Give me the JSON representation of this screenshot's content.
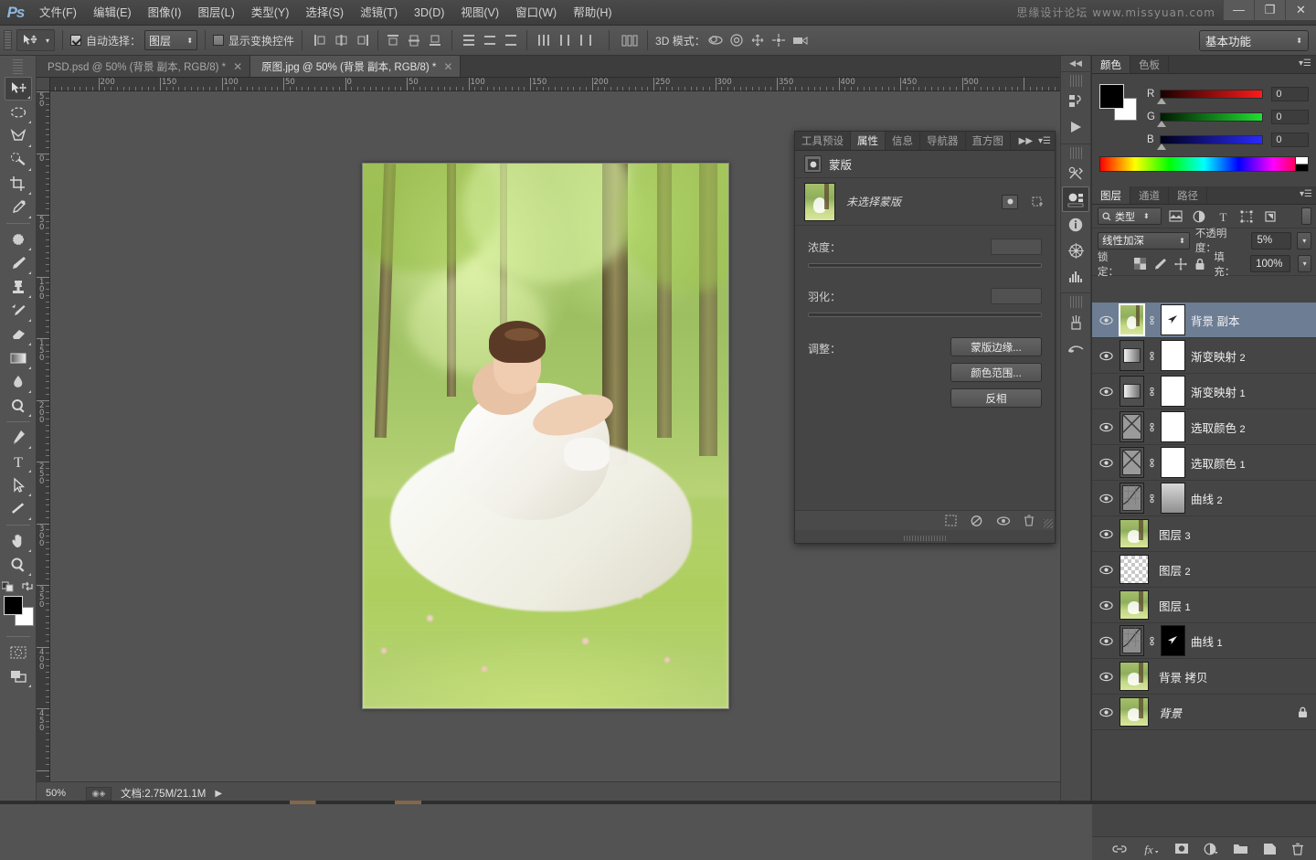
{
  "app": {
    "logo": "Ps",
    "watermark": "思缘设计论坛  www.missyuan.com"
  },
  "menubar": {
    "items": [
      {
        "label": "文件(F)"
      },
      {
        "label": "编辑(E)"
      },
      {
        "label": "图像(I)"
      },
      {
        "label": "图层(L)"
      },
      {
        "label": "类型(Y)"
      },
      {
        "label": "选择(S)"
      },
      {
        "label": "滤镜(T)"
      },
      {
        "label": "3D(D)"
      },
      {
        "label": "视图(V)"
      },
      {
        "label": "窗口(W)"
      },
      {
        "label": "帮助(H)"
      }
    ],
    "window_controls": {
      "minimize": "—",
      "restore": "❐",
      "close": "✕"
    }
  },
  "options_bar": {
    "auto_select_label": "自动选择：",
    "auto_select_checked": true,
    "auto_select_value": "图层",
    "show_transform_label": "显示变换控件",
    "show_transform_checked": false,
    "three_d_label": "3D 模式：",
    "workspace": "基本功能"
  },
  "toolbar": {
    "tools": [
      {
        "name": "move-tool",
        "selected": true
      },
      {
        "name": "marquee-tool",
        "selected": false
      },
      {
        "name": "lasso-tool",
        "selected": false
      },
      {
        "name": "quick-selection-tool",
        "selected": false
      },
      {
        "name": "crop-tool",
        "selected": false
      },
      {
        "name": "eyedropper-tool",
        "selected": false
      },
      {
        "name": "healing-brush-tool",
        "selected": false
      },
      {
        "name": "brush-tool",
        "selected": false
      },
      {
        "name": "clone-stamp-tool",
        "selected": false
      },
      {
        "name": "history-brush-tool",
        "selected": false
      },
      {
        "name": "eraser-tool",
        "selected": false
      },
      {
        "name": "gradient-tool",
        "selected": false
      },
      {
        "name": "blur-tool",
        "selected": false
      },
      {
        "name": "dodge-tool",
        "selected": false
      },
      {
        "name": "pen-tool",
        "selected": false
      },
      {
        "name": "type-tool",
        "selected": false
      },
      {
        "name": "path-selection-tool",
        "selected": false
      },
      {
        "name": "line-tool",
        "selected": false
      },
      {
        "name": "hand-tool",
        "selected": false
      },
      {
        "name": "zoom-tool",
        "selected": false
      }
    ],
    "foreground_color": "#000000",
    "background_color": "#ffffff"
  },
  "document_tabs": [
    {
      "label": "PSD.psd @ 50% (背景 副本, RGB/8) *",
      "active": false,
      "close": "✕"
    },
    {
      "label": "原图.jpg @ 50% (背景 副本, RGB/8) *",
      "active": true,
      "close": "✕"
    }
  ],
  "rulers": {
    "horizontal_labels": [
      "0",
      "200",
      "150",
      "100",
      "50",
      "0",
      "50",
      "100",
      "150",
      "200",
      "250",
      "300",
      "350",
      "400",
      "450",
      "500"
    ],
    "vertical_labels": [
      "5 0",
      "0",
      "5 0",
      "1 0 0",
      "1 5 0",
      "2 0 0",
      "2 5 0",
      "3 0 0",
      "3 5 0",
      "4 0 0",
      "4 5 0"
    ]
  },
  "status_bar": {
    "zoom": "50%",
    "doc_label": "文档:2.75M/21.1M",
    "arrow": "▶"
  },
  "properties_panel": {
    "tabs": [
      {
        "label": "工具预设",
        "active": false
      },
      {
        "label": "属性",
        "active": true
      },
      {
        "label": "信息",
        "active": false
      },
      {
        "label": "导航器",
        "active": false
      },
      {
        "label": "直方图",
        "active": false
      }
    ],
    "collapse": "▶▶",
    "menu": "▾☰",
    "title": "蒙版",
    "mask_name": "未选择蒙版",
    "density_label": "浓度：",
    "density_value": "",
    "feather_label": "羽化：",
    "feather_value": "",
    "adjust_label": "调整：",
    "buttons": [
      {
        "label": "蒙版边缘..."
      },
      {
        "label": "颜色范围..."
      },
      {
        "label": "反相"
      }
    ],
    "footer_icons": [
      "selection-from-mask-icon",
      "apply-mask-icon",
      "toggle-mask-icon",
      "delete-mask-icon"
    ]
  },
  "color_panel": {
    "tabs": [
      {
        "label": "颜色",
        "active": true
      },
      {
        "label": "色板",
        "active": false
      }
    ],
    "menu": "▾☰",
    "channels": [
      {
        "name": "R",
        "value": "0",
        "color": "#ff0000"
      },
      {
        "name": "G",
        "value": "0",
        "color": "#00cc22"
      },
      {
        "name": "B",
        "value": "0",
        "color": "#2222ff"
      }
    ],
    "foreground": "#000000",
    "background": "#ffffff"
  },
  "layers_panel": {
    "tabs": [
      {
        "label": "图层",
        "active": true
      },
      {
        "label": "通道",
        "active": false
      },
      {
        "label": "路径",
        "active": false
      }
    ],
    "menu": "▾☰",
    "filter_type": "类型",
    "filter_icons": [
      "pixel-filter-icon",
      "adjustment-filter-icon",
      "type-filter-icon",
      "shape-filter-icon",
      "smartobject-filter-icon"
    ],
    "blend_mode": "线性加深",
    "opacity_label": "不透明度：",
    "opacity_value": "5%",
    "lock_label": "锁定：",
    "lock_icons": [
      "lock-transparency-icon",
      "lock-image-icon",
      "lock-position-icon",
      "lock-all-icon"
    ],
    "fill_label": "填充：",
    "fill_value": "100%",
    "layers": [
      {
        "name": "背景 副本",
        "num": "",
        "selected": true,
        "visible": true,
        "thumb": "photo",
        "mask": "white-arrow",
        "linked": true,
        "locked": false,
        "italic": false
      },
      {
        "name": "渐变映射",
        "num": "2",
        "selected": false,
        "visible": true,
        "thumb": "gradmap",
        "mask": "white",
        "linked": true,
        "locked": false,
        "italic": false
      },
      {
        "name": "渐变映射",
        "num": "1",
        "selected": false,
        "visible": true,
        "thumb": "gradmap",
        "mask": "white",
        "linked": true,
        "locked": false,
        "italic": false
      },
      {
        "name": "选取颜色",
        "num": "2",
        "selected": false,
        "visible": true,
        "thumb": "selcolor",
        "mask": "white",
        "linked": true,
        "locked": false,
        "italic": false
      },
      {
        "name": "选取颜色",
        "num": "1",
        "selected": false,
        "visible": true,
        "thumb": "selcolor",
        "mask": "white",
        "linked": true,
        "locked": false,
        "italic": false
      },
      {
        "name": "曲线",
        "num": "2",
        "selected": false,
        "visible": true,
        "thumb": "curve",
        "mask": "photo",
        "linked": true,
        "locked": false,
        "italic": false
      },
      {
        "name": "图层",
        "num": "3",
        "selected": false,
        "visible": true,
        "thumb": "photo",
        "mask": "none",
        "linked": false,
        "locked": false,
        "italic": false
      },
      {
        "name": "图层",
        "num": "2",
        "selected": false,
        "visible": true,
        "thumb": "checker",
        "mask": "none",
        "linked": false,
        "locked": false,
        "italic": false
      },
      {
        "name": "图层",
        "num": "1",
        "selected": false,
        "visible": true,
        "thumb": "photo",
        "mask": "none",
        "linked": false,
        "locked": false,
        "italic": false
      },
      {
        "name": "曲线",
        "num": "1",
        "selected": false,
        "visible": true,
        "thumb": "curve",
        "mask": "black-arrow",
        "linked": true,
        "locked": false,
        "italic": false
      },
      {
        "name": "背景 拷贝",
        "num": "",
        "selected": false,
        "visible": true,
        "thumb": "photo",
        "mask": "none",
        "linked": false,
        "locked": false,
        "italic": false
      },
      {
        "name": "背景",
        "num": "",
        "selected": false,
        "visible": true,
        "thumb": "photo",
        "mask": "none",
        "linked": false,
        "locked": true,
        "italic": true
      }
    ],
    "footer_icons": [
      "link-layers-icon",
      "layer-style-icon",
      "add-mask-icon",
      "new-adjustment-icon",
      "new-group-icon",
      "new-layer-icon",
      "delete-layer-icon"
    ],
    "footer_labels": {
      "fx": "fx"
    }
  },
  "dock_strip": {
    "collapse": "◀◀",
    "icons": [
      {
        "name": "history-icon"
      },
      {
        "name": "actions-play-icon"
      },
      {
        "name": "tool-presets-icon"
      },
      {
        "name": "adjustments-icon"
      },
      {
        "name": "info-icon"
      },
      {
        "name": "navigator-icon"
      },
      {
        "name": "histogram-icon"
      },
      {
        "name": "brush-presets-icon"
      },
      {
        "name": "clone-source-icon"
      }
    ]
  }
}
